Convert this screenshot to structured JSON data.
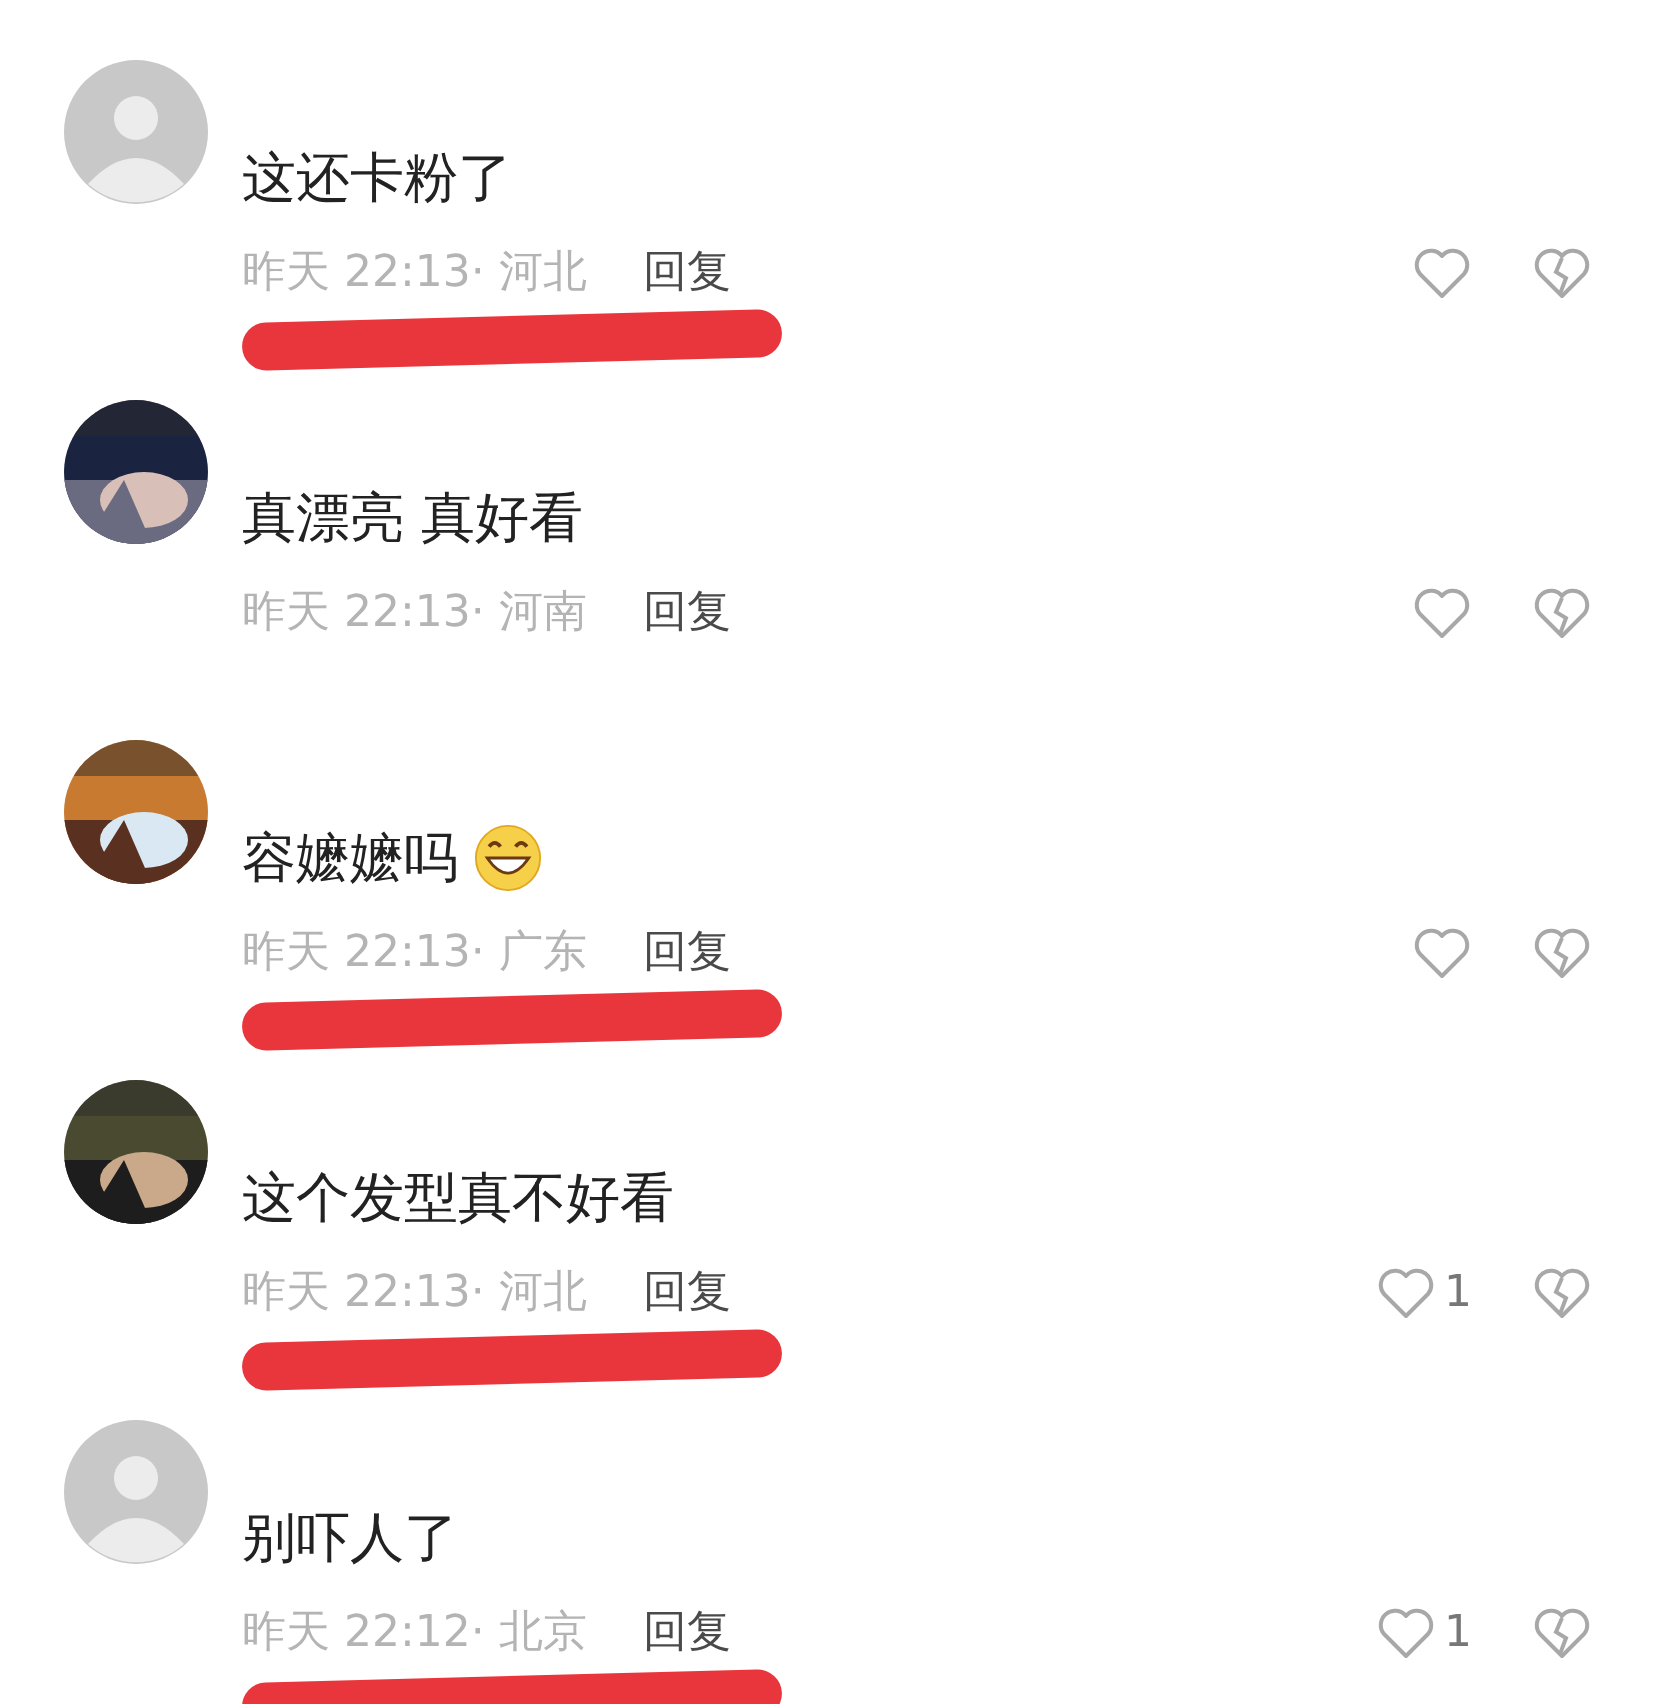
{
  "comments": [
    {
      "avatar": {
        "kind": "default"
      },
      "text": "这还卡粉了",
      "emoji": false,
      "time": "昨天 22:13·",
      "region": "河北",
      "reply": "回复",
      "scribble": true
    },
    {
      "text": "真漂亮 真好看",
      "emoji": false,
      "time": "昨天 22:13·",
      "region": "河南",
      "reply": "回复",
      "scribble": false
    },
    {
      "text": "容嬷嬷吗",
      "emoji": true,
      "time": "昨天 22:13·",
      "region": "广东",
      "reply": "回复",
      "scribble": true
    },
    {
      "text": "这个发型真不好看",
      "emoji": false,
      "time": "昨天 22:13·",
      "region": "河北",
      "reply": "回复",
      "likes": "1",
      "scribble": true
    },
    {
      "avatar": {
        "kind": "default"
      },
      "text": "别吓人了",
      "emoji": false,
      "time": "昨天 22:12·",
      "region": "北京",
      "reply": "回复",
      "likes": "1",
      "scribble": true
    }
  ]
}
